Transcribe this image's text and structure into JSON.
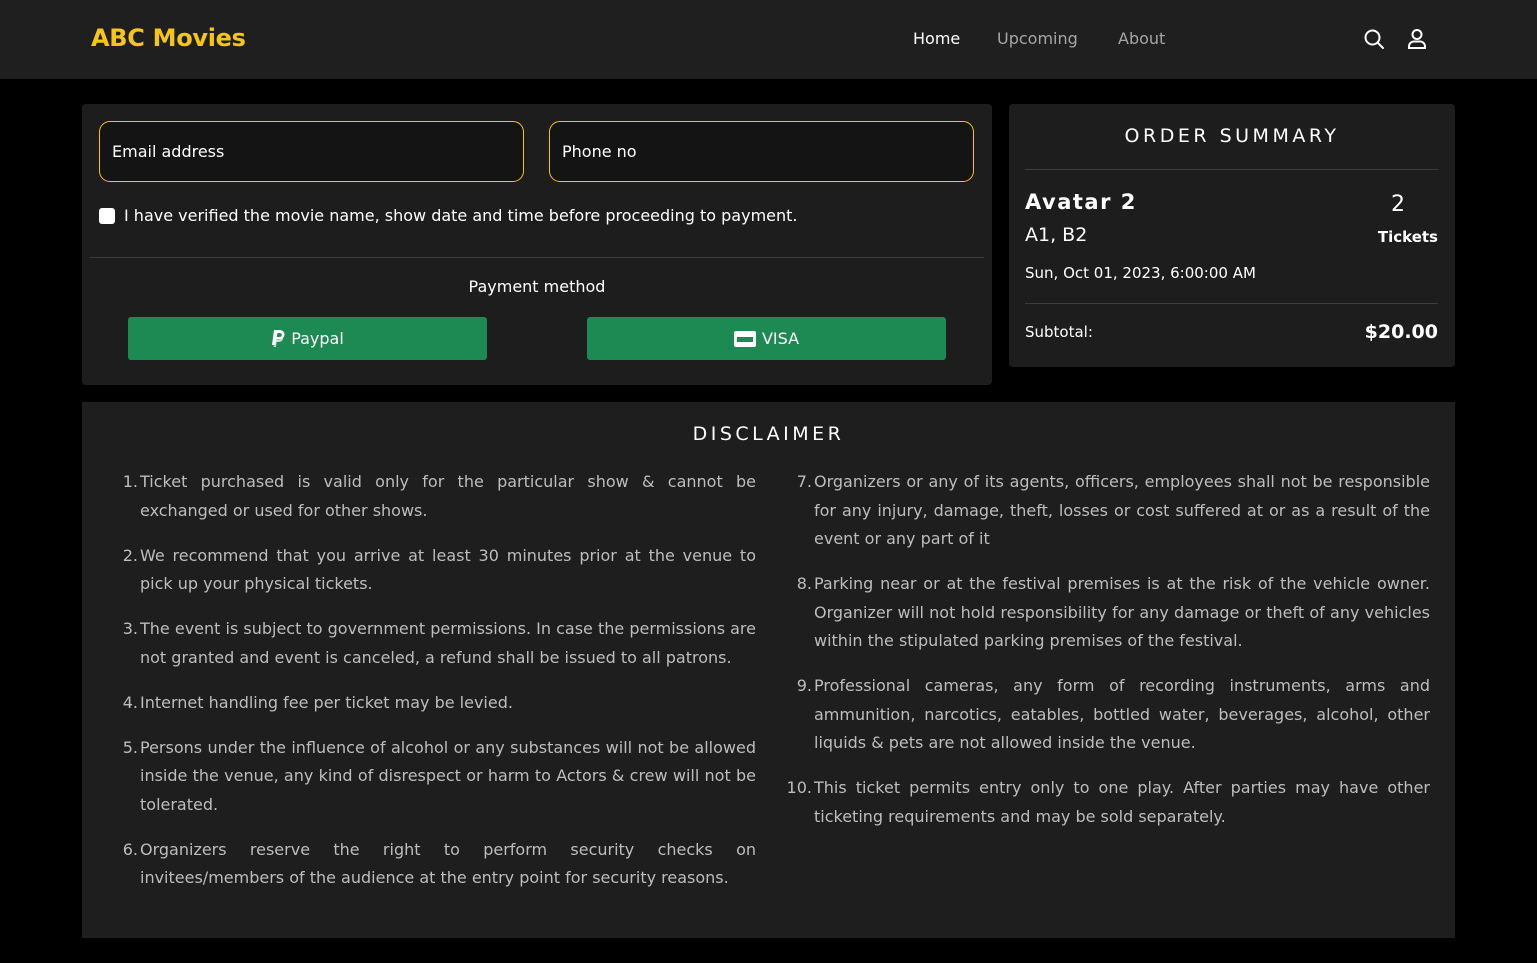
{
  "header": {
    "logo": "ABC Movies",
    "nav": [
      "Home",
      "Upcoming",
      "About"
    ],
    "icons": [
      "search-icon",
      "user-icon"
    ],
    "accent": "#f5c518"
  },
  "form": {
    "email_placeholder": "Email address",
    "phone_placeholder": "Phone no",
    "verify_label": "I have verified the movie name, show date and time before proceeding to payment.",
    "payment_title": "Payment method",
    "paypal_label": "Paypal",
    "visa_label": "VISA",
    "button_color": "#1e8a53"
  },
  "order": {
    "title": "ORDER SUMMARY",
    "movie": "Avatar 2",
    "seats": "A1, B2",
    "show_time": "Sun, Oct 01, 2023, 6:00:00 AM",
    "ticket_count": "2",
    "ticket_label": "Tickets",
    "subtotal_label": "Subtotal:",
    "subtotal_value": "$20.00"
  },
  "disclaimer": {
    "title": "DISCLAIMER",
    "left": [
      {
        "num": "1.",
        "text": "Ticket purchased is valid only for the particular show & cannot be exchanged or used for other shows."
      },
      {
        "num": "2.",
        "text": "We recommend that you arrive at least 30 minutes prior at the venue to pick up your physical tickets."
      },
      {
        "num": "3.",
        "text": "The event is subject to government permissions. In case the permissions are not granted and event is canceled, a refund shall be issued to all patrons."
      },
      {
        "num": "4.",
        "text": "Internet handling fee per ticket may be levied."
      },
      {
        "num": "5.",
        "text": "Persons under the influence of alcohol or any substances will not be allowed inside the venue, any kind of disrespect or harm to Actors & crew will not be tolerated."
      },
      {
        "num": "6.",
        "text": "Organizers reserve the right to perform security checks on invitees/members of the audience at the entry point for security reasons."
      }
    ],
    "right": [
      {
        "num": "7.",
        "text": "Organizers or any of its agents, officers, employees shall not be responsible for any injury, damage, theft, losses or cost suffered at or as a result of the event or any part of it"
      },
      {
        "num": "8.",
        "text": "Parking near or at the festival premises is at the risk of the vehicle owner. Organizer will not hold responsibility for any damage or theft of any vehicles within the stipulated parking premises of the festival."
      },
      {
        "num": "9.",
        "text": "Professional cameras, any form of recording instruments, arms and ammunition, narcotics, eatables, bottled water, beverages, alcohol, other liquids & pets are not allowed inside the venue."
      },
      {
        "num": "10.",
        "text": "This ticket permits entry only to one play. After parties may have other ticketing requirements and may be sold separately."
      }
    ]
  }
}
